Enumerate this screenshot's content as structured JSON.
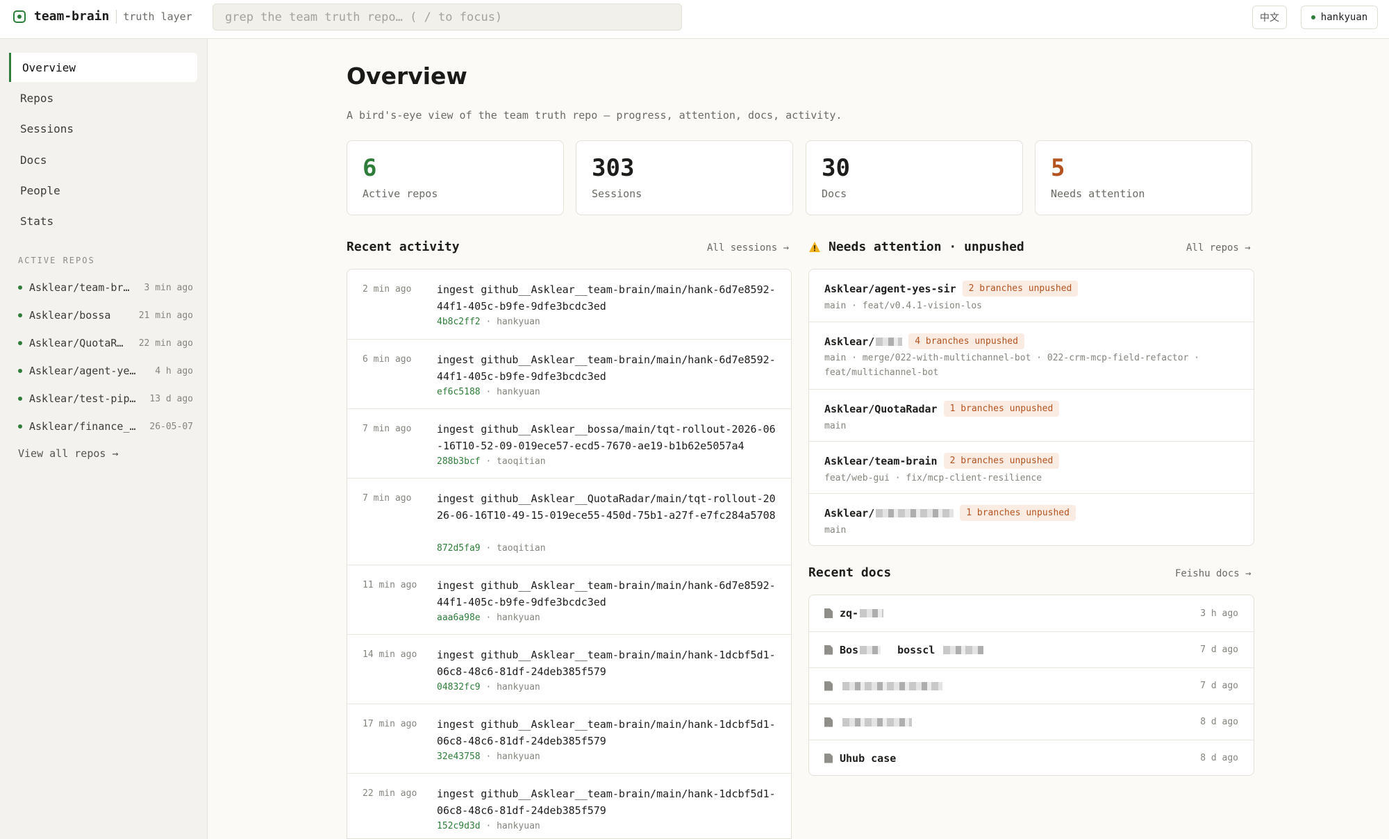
{
  "topbar": {
    "brand": "team-brain",
    "tagline": "truth layer",
    "search_placeholder": "grep the team truth repo…  ( / to focus)",
    "lang": "中文",
    "user": "hankyuan"
  },
  "sidebar": {
    "nav": [
      "Overview",
      "Repos",
      "Sessions",
      "Docs",
      "People",
      "Stats"
    ],
    "section_label": "ACTIVE REPOS",
    "repos": [
      {
        "name": "Asklear/team-br…",
        "time": "3 min ago"
      },
      {
        "name": "Asklear/bossa",
        "time": "21 min ago"
      },
      {
        "name": "Asklear/QuotaR…",
        "time": "22 min ago"
      },
      {
        "name": "Asklear/agent-ye…",
        "time": "4 h ago"
      },
      {
        "name": "Asklear/test-pip…",
        "time": "13 d ago"
      },
      {
        "name": "Asklear/finance_…",
        "time": "26-05-07"
      }
    ],
    "view_all": "View all repos →"
  },
  "main": {
    "title": "Overview",
    "subtitle": "A bird's-eye view of the team truth repo — progress, attention, docs, activity.",
    "stats": [
      {
        "value": "6",
        "label": "Active repos",
        "color": "#2e7d3a"
      },
      {
        "value": "303",
        "label": "Sessions",
        "color": "#1d1d1b"
      },
      {
        "value": "30",
        "label": "Docs",
        "color": "#1d1d1b"
      },
      {
        "value": "5",
        "label": "Needs attention",
        "color": "#b4531f"
      }
    ]
  },
  "activity": {
    "title": "Recent activity",
    "link": "All sessions →",
    "items": [
      {
        "time": "2 min ago",
        "msg": "ingest github__Asklear__team-brain/main/hank-6d7e8592-44f1-405c-b9fe-9dfe3bcdc3ed",
        "hash": "4b8c2ff2",
        "user": "hankyuan"
      },
      {
        "time": "6 min ago",
        "msg": "ingest github__Asklear__team-brain/main/hank-6d7e8592-44f1-405c-b9fe-9dfe3bcdc3ed",
        "hash": "ef6c5188",
        "user": "hankyuan"
      },
      {
        "time": "7 min ago",
        "msg": "ingest github__Asklear__bossa/main/tqt-rollout-2026-06-16T10-52-09-019ece57-ecd5-7670-ae19-b1b62e5057a4",
        "hash": "288b3bcf",
        "user": "taoqitian"
      },
      {
        "time": "7 min ago",
        "msg": "ingest github__Asklear__QuotaRadar/main/tqt-rollout-2026-06-16T10-49-15-019ece55-450d-75b1-a27f-e7fc284a5708",
        "hash": "872d5fa9",
        "user": "taoqitian"
      },
      {
        "time": "11 min ago",
        "msg": "ingest github__Asklear__team-brain/main/hank-6d7e8592-44f1-405c-b9fe-9dfe3bcdc3ed",
        "hash": "aaa6a98e",
        "user": "hankyuan"
      },
      {
        "time": "14 min ago",
        "msg": "ingest github__Asklear__team-brain/main/hank-1dcbf5d1-06c8-48c6-81df-24deb385f579",
        "hash": "04832fc9",
        "user": "hankyuan"
      },
      {
        "time": "17 min ago",
        "msg": "ingest github__Asklear__team-brain/main/hank-1dcbf5d1-06c8-48c6-81df-24deb385f579",
        "hash": "32e43758",
        "user": "hankyuan"
      },
      {
        "time": "22 min ago",
        "msg": "ingest github__Asklear__team-brain/main/hank-1dcbf5d1-06c8-48c6-81df-24deb385f579",
        "hash": "152c9d3d",
        "user": "hankyuan"
      }
    ]
  },
  "attention": {
    "title": "Needs attention · unpushed",
    "link": "All repos →",
    "items": [
      {
        "name": "Asklear/agent-yes-sir",
        "badge": "2 branches unpushed",
        "branches": "main · feat/v0.4.1-vision-los"
      },
      {
        "name": "Asklear/",
        "badge": "4 branches unpushed",
        "branches": "main · merge/022-with-multichannel-bot · 022-crm-mcp-field-refactor · feat/multichannel-bot"
      },
      {
        "name": "Asklear/QuotaRadar",
        "badge": "1 branches unpushed",
        "branches": "main"
      },
      {
        "name": "Asklear/team-brain",
        "badge": "2 branches unpushed",
        "branches": "feat/web-gui · fix/mcp-client-resilience"
      },
      {
        "name": "Asklear/",
        "badge": "1 branches unpushed",
        "branches": "main"
      }
    ]
  },
  "docs": {
    "title": "Recent docs",
    "link": "Feishu docs →",
    "items": [
      {
        "name": "zq-",
        "time": "3 h ago"
      },
      {
        "name": "Bos",
        "name2": "bosscl",
        "time": "7 d ago"
      },
      {
        "name": "",
        "time": "7 d ago"
      },
      {
        "name": "",
        "time": "8 d ago"
      },
      {
        "name": "Uhub case",
        "time": "8 d ago"
      }
    ]
  }
}
